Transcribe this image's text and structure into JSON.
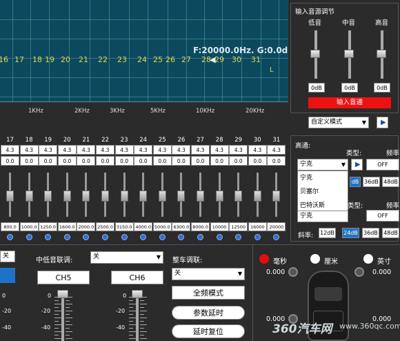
{
  "eq": {
    "bands_visible": [
      "16",
      "17",
      "18",
      "19",
      "20",
      "21",
      "22",
      "23",
      "24",
      "25",
      "26",
      "27",
      "28",
      "29",
      "30",
      "31"
    ],
    "readout": "F:20000.0Hz. G:0.0d",
    "cursor": "◀",
    "channel_marker": "L",
    "freq_axis": [
      "1KHz",
      "2KHz",
      "3KHz",
      "5KHz",
      "10KHz",
      "20KHz"
    ]
  },
  "strip": {
    "bands": [
      {
        "num": "17",
        "gain": "4.3",
        "q": "0.0",
        "freq": "800.0"
      },
      {
        "num": "18",
        "gain": "4.3",
        "q": "0.0",
        "freq": "1000.0"
      },
      {
        "num": "19",
        "gain": "4.3",
        "q": "0.0",
        "freq": "1250.0"
      },
      {
        "num": "20",
        "gain": "4.3",
        "q": "0.0",
        "freq": "1600.0"
      },
      {
        "num": "21",
        "gain": "4.3",
        "q": "0.0",
        "freq": "2000.0"
      },
      {
        "num": "22",
        "gain": "4.3",
        "q": "0.0",
        "freq": "2500.0"
      },
      {
        "num": "23",
        "gain": "4.3",
        "q": "0.0",
        "freq": "3150.0"
      },
      {
        "num": "24",
        "gain": "4.3",
        "q": "0.0",
        "freq": "4000.0"
      },
      {
        "num": "25",
        "gain": "4.3",
        "q": "0.0",
        "freq": "5000.0"
      },
      {
        "num": "26",
        "gain": "4.3",
        "q": "0.0",
        "freq": "6300.0"
      },
      {
        "num": "27",
        "gain": "4.3",
        "q": "0.0",
        "freq": "8000.0"
      },
      {
        "num": "28",
        "gain": "4.3",
        "q": "0.0",
        "freq": "10000"
      },
      {
        "num": "29",
        "gain": "4.3",
        "q": "0.0",
        "freq": "12500"
      },
      {
        "num": "30",
        "gain": "4.3",
        "q": "0.0",
        "freq": "16000"
      },
      {
        "num": "31",
        "gain": "4.3",
        "q": "0.0",
        "freq": "20000"
      }
    ]
  },
  "input_source": {
    "title": "输入音源调节",
    "bass_label": "低音",
    "mid_label": "中音",
    "treble_label": "高音",
    "bass_value": "0dB",
    "mid_value": "0dB",
    "treble_value": "0dB",
    "input_channel_button": "输入音通",
    "mode_select": "自定义模式",
    "mode_arrow": "▶"
  },
  "crossover": {
    "highpass_label": "高通:",
    "type_label": "类型:",
    "freq_label_cut": "频率",
    "type_value": "宁克",
    "freq_value": "OFF",
    "arrow": "▶",
    "options": [
      "宁克",
      "贝塞尔",
      "巴特沃斯"
    ],
    "slopes": [
      "dB",
      "36dB",
      "48dB"
    ],
    "type_label_2": "类型:",
    "freq_label_2": "频率",
    "type_value_2": "宁克",
    "freq_value_2": "OFF",
    "slope_label": "斜率:",
    "slopes_2": [
      "12dB",
      "24dB",
      "36dB",
      "48dB"
    ]
  },
  "bottom": {
    "left_select_value": "关",
    "midlow_label": "中低音联调:",
    "midlow_value": "关",
    "ch5": "CH5",
    "ch6": "CH6",
    "scale": [
      "0",
      "-20",
      "-40"
    ],
    "car_label": "整车调联:",
    "car_value": "关",
    "full_mode": "全频模式",
    "param_delay": "参数延时",
    "delay_reset": "延时复位",
    "unit_ms": "毫秒",
    "unit_cm": "厘米",
    "unit_inch": "英寸",
    "delay_fl": "0.000",
    "delay_fr": "0.000",
    "delay_rl": "0.000",
    "delay_rr": "0.000",
    "watermark": "360汽车网",
    "watermark_url": "www.360qc.com"
  },
  "colors": {
    "graph_bg": "#0b4a5e",
    "band_yellow": "#e8d34a",
    "red_button": "#e01010",
    "select_blue": "#1e73c8"
  }
}
